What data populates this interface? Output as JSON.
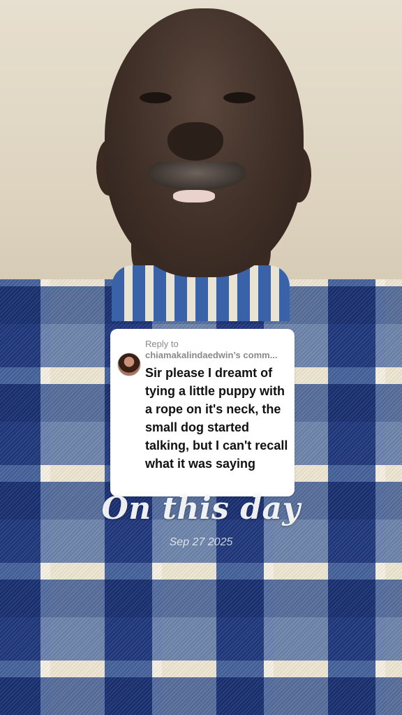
{
  "reply": {
    "prefix": "Reply to",
    "username": "chiamakalindaedwin’s comm...",
    "comment": "Sir please I dreamt of tying a little puppy with a rope on it's neck, the small dog started talking, but I can't recall what it was saying"
  },
  "overlay": {
    "title": "On this day",
    "date": "Sep 27 2025"
  },
  "colors": {
    "wall": "#e2d8c5",
    "shirt_blue": "#2f5aa4",
    "card_bg": "#ffffff"
  }
}
